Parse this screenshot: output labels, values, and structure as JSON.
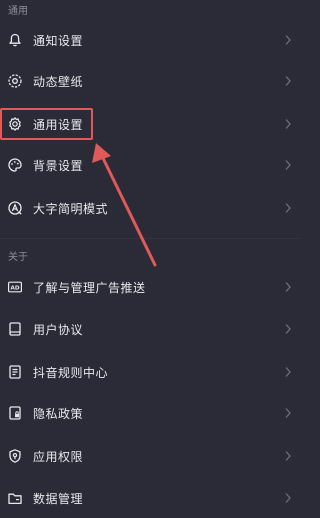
{
  "sections": {
    "general": "通用",
    "about": "关于"
  },
  "general_items": [
    {
      "label": "通知设置",
      "icon": "bell-icon"
    },
    {
      "label": "动态壁纸",
      "icon": "live-wallpaper-icon"
    },
    {
      "label": "通用设置",
      "icon": "gear-icon"
    },
    {
      "label": "背景设置",
      "icon": "palette-icon"
    },
    {
      "label": "大字简明模式",
      "icon": "large-font-icon"
    }
  ],
  "about_items": [
    {
      "label": "了解与管理广告推送",
      "icon": "ad-icon"
    },
    {
      "label": "用户协议",
      "icon": "document-icon"
    },
    {
      "label": "抖音规则中心",
      "icon": "rules-icon"
    },
    {
      "label": "隐私政策",
      "icon": "privacy-lock-icon"
    },
    {
      "label": "应用权限",
      "icon": "shield-icon"
    },
    {
      "label": "数据管理",
      "icon": "data-folder-icon"
    }
  ],
  "annotation": {
    "highlighted_item": "通用设置",
    "color": "#e05a5a"
  },
  "colors": {
    "background": "#2a2b37",
    "text": "#e8e8ee",
    "section_label": "#8d8e99"
  }
}
